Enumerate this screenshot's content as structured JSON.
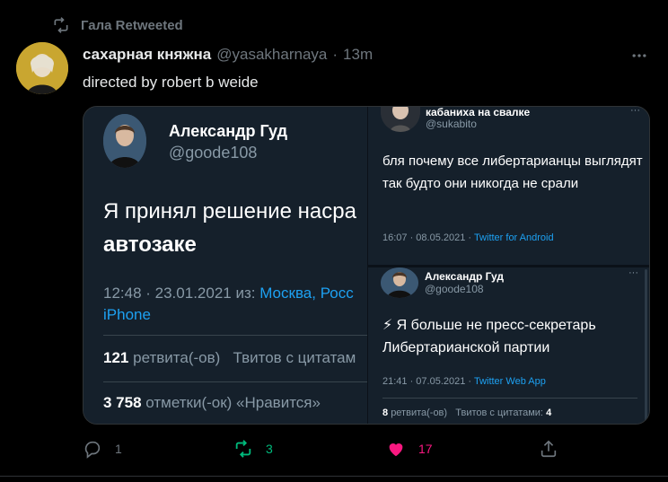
{
  "retweeted_by": {
    "text": "Гала Retweeted",
    "icon": "retweet-icon"
  },
  "tweet": {
    "author_name": "сахарная княжна",
    "author_handle": "@yasakharnaya",
    "separator": "·",
    "time": "13m",
    "text": "directed by robert b weide",
    "more_icon": "more-icon"
  },
  "media": {
    "left": {
      "name": "Александр Гуд",
      "handle": "@goode108",
      "text_line1": "Я принял решение насра",
      "text_line2": "автозаке",
      "meta_prefix": "12:48 · 23.01.2021 из: ",
      "meta_link": "Москва, Росс",
      "meta_line2": "iPhone",
      "retweets_count": "121",
      "retweets_label": "ретвита(-ов)",
      "quotes_label": "Твитов с цитатам",
      "likes_count": "3 758",
      "likes_label": "отметки(-ок) «Нравится»"
    },
    "right_top": {
      "name": "кабаниха на свалке",
      "handle": "@sukabito",
      "more": "···",
      "text": "бля почему все либертарианцы выглядят так будто они никогда не срали",
      "meta_time": "16:07 · 08.05.2021 · ",
      "meta_source": "Twitter for Android"
    },
    "right_bottom": {
      "name": "Александр Гуд",
      "handle": "@goode108",
      "more": "···",
      "text": "⚡ Я больше не пресс-секретарь Либертарианской партии",
      "meta_time": "21:41 · 07.05.2021 · ",
      "meta_source": "Twitter Web App",
      "retweets_count": "8",
      "retweets_label": "ретвита(-ов)",
      "quotes_label": "Твитов с цитатами:",
      "quotes_count": "4"
    }
  },
  "actions": {
    "reply_count": "1",
    "retweet_count": "3",
    "like_count": "17",
    "colors": {
      "retweet": "#00ba7c",
      "like": "#f91880",
      "muted": "#6e767d"
    }
  }
}
